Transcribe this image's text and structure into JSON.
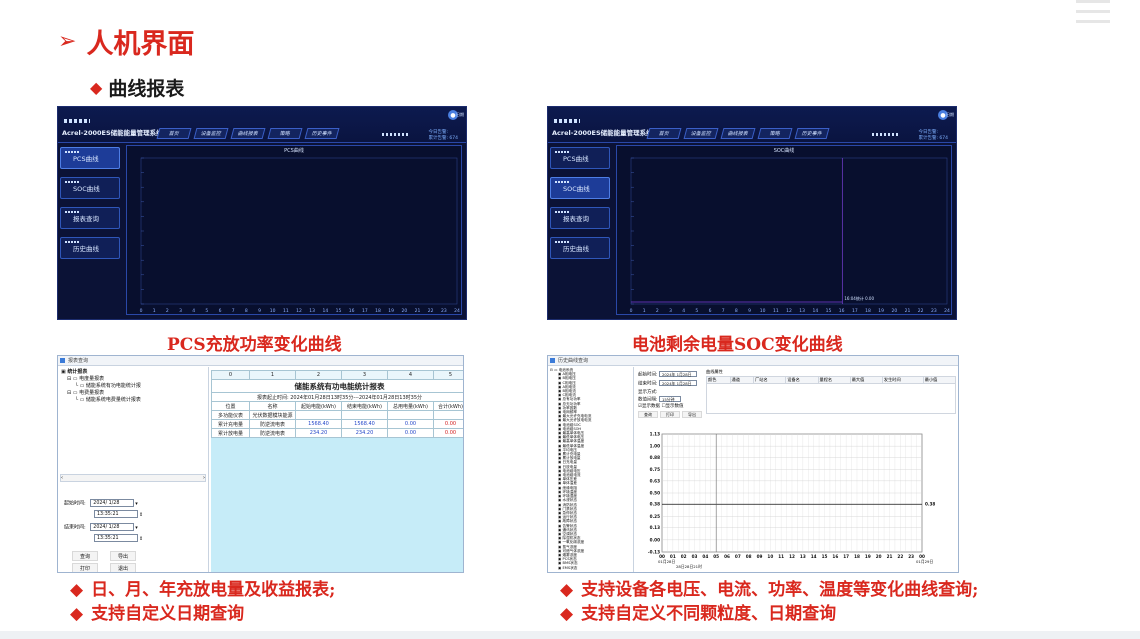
{
  "slide": {
    "title": "人机界面",
    "title_marker": "➢",
    "subtitle": "曲线报表",
    "subtitle_marker": "◆"
  },
  "pcs_app": {
    "system_name": "Acrel-2000ES储能能量管理系统",
    "nav": [
      "首页",
      "设备监控",
      "曲线报表",
      "策略",
      "历史事件"
    ],
    "user": "日期",
    "status": [
      "今日告警:",
      "累计告警: 674"
    ],
    "side": [
      "PCS曲线",
      "SOC曲线",
      "报表查询",
      "历史曲线"
    ],
    "plot_title": "PCS曲线",
    "caption": "PCS充放功率变化曲线"
  },
  "soc_app": {
    "system_name": "Acrel-2000ES储能能量管理系统",
    "nav": [
      "首页",
      "设备监控",
      "曲线报表",
      "策略",
      "历史事件"
    ],
    "user": "日期",
    "status": [
      "今日告警:",
      "累计告警: 674"
    ],
    "side": [
      "PCS曲线",
      "SOC曲线",
      "报表查询",
      "历史曲线"
    ],
    "plot_title": "SOC曲线",
    "tooltip": "16:04统计 0.00",
    "caption": "电池剩余电量SOC变化曲线"
  },
  "report_win": {
    "title": "报表查询",
    "tree": [
      "统计报表",
      "电度量报表",
      "储能系统有功电能统计报",
      "电费量报表",
      "储能系统电费量统计报表"
    ],
    "start_label": "起始时间:",
    "start_date": "2024/ 1/28",
    "start_time": "13:35:21",
    "end_label": "结束时间:",
    "end_date": "2024/ 1/28",
    "end_time": "13:35:21",
    "buttons": [
      "查询",
      "导出",
      "打印",
      "退出"
    ],
    "col_idx": [
      "0",
      "1",
      "2",
      "3",
      "4",
      "5"
    ],
    "report_title": "储能系统有功电能统计报表",
    "report_period": "报表起止时间: 2024年01月28日13时35分---2024年01月28日13时35分",
    "headers": [
      "位置",
      "名称",
      "起始电能(kWh)",
      "结束电能(kWh)",
      "总用电量(kWh)",
      "合计(kWh)"
    ],
    "row0": [
      "多功能仪表",
      "光伏数据模块能源"
    ],
    "rows": [
      [
        "累计充电量",
        "防逆流电表",
        "1568.40",
        "1568.40",
        "0.00",
        "0.00"
      ],
      [
        "累计放电量",
        "防逆流电表",
        "234.20",
        "234.20",
        "0.00",
        "0.00"
      ]
    ]
  },
  "curve_win": {
    "title": "历史曲线查询",
    "tree_root": "电池系统",
    "tree_items": [
      "A相电压",
      "B相电压",
      "C相电压",
      "A相电流",
      "B相电流",
      "C相电流",
      "总有功功率",
      "总无功功率",
      "功率因数",
      "电网频率",
      "最大允许充电电流",
      "最大允许放电电流",
      "电池组SOC",
      "电池组SOH",
      "最高单体电压",
      "最低单体电压",
      "最高单体温度",
      "最低单体温度",
      "平均电压",
      "累计充电量",
      "累计放电量",
      "日充电量",
      "日放电量",
      "电池组电压",
      "电池组电流",
      "单体压差",
      "单体温差",
      "绝缘电阻",
      "环境温度",
      "环境湿度",
      "水浸状态",
      "消防状态",
      "门禁状态",
      "急停状态",
      "运行状态",
      "故障状态",
      "告警状态",
      "通讯状态",
      "空调状态",
      "除湿机状态",
      "一氧化碳浓度",
      "氢气浓度",
      "可燃气体浓度",
      "烟雾浓度",
      "PCS状态",
      "BMS状态",
      "EMS状态"
    ],
    "start_label": "起始时间:",
    "start_val": "2024年 1月28日",
    "end_label": "结束时间:",
    "end_val": "2024年 1月28日",
    "mode_label": "显示方式:",
    "gran_label": "数值间隔:",
    "gran_val": "15分钟",
    "check1": "显示数据",
    "check2": "显示数值",
    "buttons": [
      "查询",
      "打印",
      "导出"
    ],
    "grid_label": "曲线属性",
    "grid_headers": [
      "颜色",
      "通道",
      "厂站名",
      "设备名",
      "量程名",
      "最大值",
      "发生时间",
      "最小值"
    ],
    "chart_data": {
      "type": "line",
      "x": [
        "00",
        "01",
        "02",
        "03",
        "04",
        "05",
        "06",
        "07",
        "08",
        "09",
        "10",
        "11",
        "12",
        "13",
        "14",
        "15",
        "16",
        "17",
        "18",
        "19",
        "20",
        "21",
        "22",
        "23",
        "00"
      ],
      "y_ticks": [
        "1.13",
        "1.00",
        "0.88",
        "0.75",
        "0.63",
        "0.50",
        "0.38",
        "0.25",
        "0.13",
        "0.00",
        "-0.13"
      ],
      "ylim": [
        -0.13,
        1.13
      ],
      "series": [
        {
          "values": [
            0.38,
            0.38,
            0.38,
            0.38,
            0.38,
            0.38,
            0.38,
            0.38,
            0.38,
            0.38,
            0.38,
            0.38,
            0.38,
            0.38,
            0.38,
            0.38,
            0.38,
            0.38,
            0.38,
            0.38,
            0.38,
            0.38,
            0.38,
            0.38,
            0.38
          ]
        }
      ],
      "end_value": "0.38",
      "x_start_label": "01月28日",
      "x_footer": "28日28日21时",
      "x_end_label": "01月29日"
    }
  },
  "bullets_left": [
    "日、月、年充放电量及收益报表;",
    "支持自定义日期查询"
  ],
  "bullets_right": [
    "支持设备各电压、电流、功率、温度等变化曲线查询;",
    "支持自定义不同颗粒度、日期查询"
  ],
  "bullet_marker": "◆",
  "colors": {
    "accent": "#d9281e",
    "app_bg": "#0b1236",
    "report_bg": "#c6ecf8"
  }
}
